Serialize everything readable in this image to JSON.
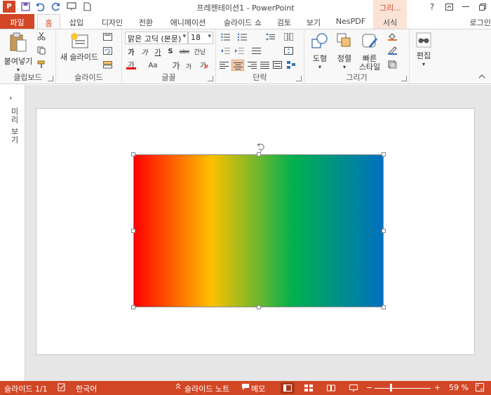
{
  "titlebar": {
    "app_icon_label": "P",
    "doc_title": "프레젠테이션1 - PowerPoint",
    "context_tab_group": "그리...",
    "help": "?",
    "qat_icons": [
      "save-icon",
      "undo-icon",
      "redo-icon",
      "slideshow-from-start-icon",
      "new-document-icon"
    ]
  },
  "tabs": {
    "file": "파일",
    "home": "홈",
    "insert": "삽입",
    "design": "디자인",
    "transitions": "전환",
    "animations": "애니메이션",
    "slideshow": "슬라이드 쇼",
    "review": "검토",
    "view": "보기",
    "nespdf": "NesPDF",
    "format": "서식",
    "signin": "로그인"
  },
  "ribbon": {
    "clipboard": {
      "label": "클립보드",
      "paste": "붙여넣기"
    },
    "slides": {
      "label": "슬라이드",
      "new_slide": "새 슬라이드"
    },
    "font": {
      "label": "글꼴",
      "font_name": "맑은 고딕 (본문)",
      "font_size": "18",
      "bold": "가",
      "italic": "가",
      "underline": "가",
      "shadow": "S",
      "strikethrough": "abc",
      "spacing": "간닏",
      "font_color": "가",
      "case": "Aa",
      "grow": "가",
      "shrink": "가"
    },
    "paragraph": {
      "label": "단락"
    },
    "drawing": {
      "label": "그리기",
      "shapes": "도형",
      "arrange": "정렬",
      "quick_styles_1": "빠른",
      "quick_styles_2": "스타일"
    },
    "editing": {
      "label": "편집"
    }
  },
  "thumbnail_pane": {
    "label": "미리 보기",
    "expand": "›"
  },
  "statusbar": {
    "slide_info": "슬라이드 1/1",
    "language": "한국어",
    "notes": "슬라이드 노트",
    "comments": "메모",
    "zoom": "59 %",
    "zoom_percent": 59
  },
  "colors": {
    "accent": "#d24726",
    "gradient_stops": [
      "#ff0000",
      "#ffc000",
      "#00b050",
      "#0070c0"
    ]
  }
}
